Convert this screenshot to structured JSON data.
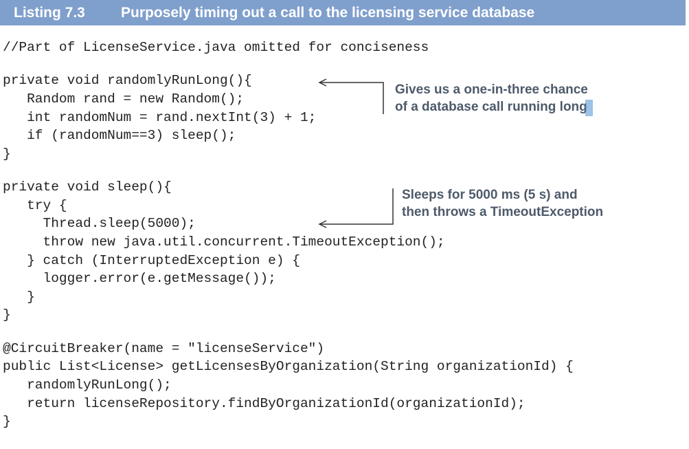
{
  "listing": {
    "number": "Listing 7.3",
    "title": "Purposely timing out a call to the licensing service database"
  },
  "code_lines": [
    "//Part of LicenseService.java omitted for conciseness",
    "private void randomlyRunLong(){",
    "   Random rand = new Random();",
    "   int randomNum = rand.nextInt(3) + 1;",
    "   if (randomNum==3) sleep();",
    "}",
    "private void sleep(){",
    "   try {",
    "     Thread.sleep(5000);",
    "     throw new java.util.concurrent.TimeoutException();",
    "   } catch (InterruptedException e) {",
    "     logger.error(e.getMessage());",
    "   }",
    "}",
    "@CircuitBreaker(name = \"licenseService\")",
    "public List<License> getLicensesByOrganization(String organizationId) {",
    "   randomlyRunLong();",
    "   return licenseRepository.findByOrganizationId(organizationId);",
    "}"
  ],
  "annotations": [
    {
      "line1": "Gives us a one-in-three chance",
      "line2": "of a database call running long"
    },
    {
      "line1": "Sleeps for 5000 ms (5 s) and",
      "line2": "then throws a TimeoutException"
    }
  ],
  "colors": {
    "header_background": "#7f9fcc",
    "header_text": "#ffffff",
    "code_text": "#222222",
    "annotation_text": "#4d5a6a",
    "connector": "#333333"
  }
}
